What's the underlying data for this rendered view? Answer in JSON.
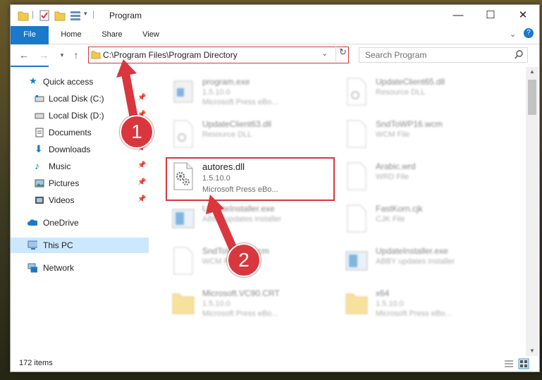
{
  "window": {
    "title": "Program"
  },
  "window_controls": {
    "minimize": "—",
    "maximize": "☐",
    "close": "✕"
  },
  "ribbon": {
    "tabs": [
      {
        "label": "File"
      },
      {
        "label": "Home"
      },
      {
        "label": "Share"
      },
      {
        "label": "View"
      }
    ]
  },
  "address": {
    "path": "C:\\Program Files\\Program Directory"
  },
  "search": {
    "placeholder": "Search Program"
  },
  "nav": {
    "items": [
      {
        "label": "Quick access"
      },
      {
        "label": "Local Disk (C:)"
      },
      {
        "label": "Local Disk (D:)"
      },
      {
        "label": "Documents"
      },
      {
        "label": "Downloads"
      },
      {
        "label": "Music"
      },
      {
        "label": "Pictures"
      },
      {
        "label": "Videos"
      },
      {
        "label": "OneDrive"
      },
      {
        "label": "This PC"
      },
      {
        "label": "Network"
      }
    ]
  },
  "files": [
    {
      "name": "program.exe",
      "version": "1.5.10.0",
      "desc": "Microsoft Press eBo..."
    },
    {
      "name": "UpdateClient65.dll",
      "version": "Resource DLL",
      "desc": ""
    },
    {
      "name": "UpdateClient63.dll",
      "version": "Resource DLL",
      "desc": ""
    },
    {
      "name": "SndToWP16.wcm",
      "version": "WCM File",
      "desc": ""
    },
    {
      "name": "autores.dll",
      "version": "1.5.10.0",
      "desc": "Microsoft Press eBo..."
    },
    {
      "name": "Arabic.wrd",
      "version": "WRD File",
      "desc": ""
    },
    {
      "name": "UpdateInstaller.exe",
      "version": "ABBY updates installer",
      "desc": ""
    },
    {
      "name": "FastKorn.cjk",
      "version": "CJK File",
      "desc": ""
    },
    {
      "name": "SndToWP16.wcm",
      "version": "WCM File",
      "desc": ""
    },
    {
      "name": "UpdateInstaller.exe",
      "version": "ABBY updates installer",
      "desc": ""
    },
    {
      "name": "Microsoft.VC90.CRT",
      "version": "1.5.10.0",
      "desc": "Microsoft Press eBo..."
    },
    {
      "name": "x64",
      "version": "1.5.10.0",
      "desc": "Microsoft Press eBo..."
    }
  ],
  "status": {
    "count": "172 items"
  },
  "annotations": {
    "step1": "1",
    "step2": "2"
  },
  "colors": {
    "accent": "#1979ca",
    "highlight": "#d9363e",
    "selected": "#cce8ff"
  }
}
